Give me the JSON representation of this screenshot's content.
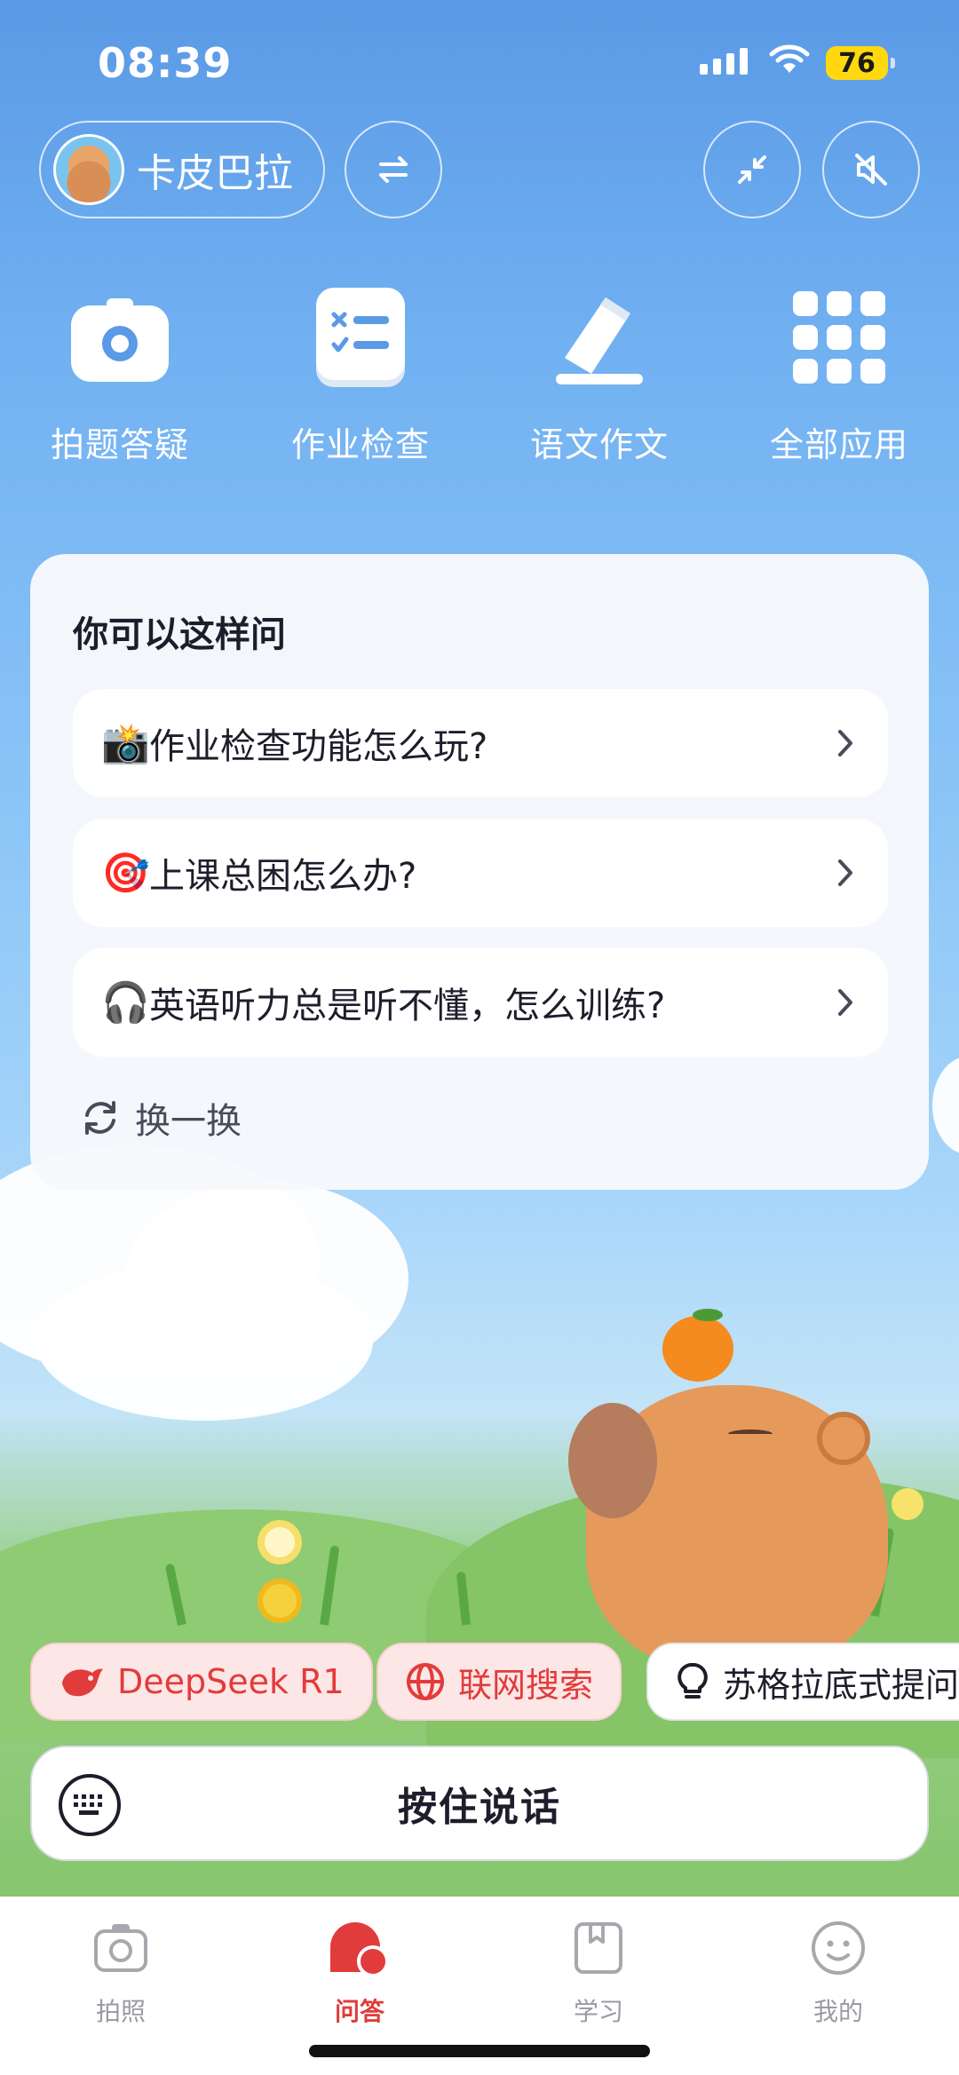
{
  "status_bar": {
    "time": "08:39",
    "battery": "76"
  },
  "header": {
    "profile_name": "卡皮巴拉",
    "icons": [
      "swap-icon",
      "collapse-icon",
      "mute-icon"
    ]
  },
  "quick_apps": [
    {
      "label": "拍题答疑",
      "icon": "camera-icon"
    },
    {
      "label": "作业检查",
      "icon": "homework-check-icon"
    },
    {
      "label": "语文作文",
      "icon": "pen-icon"
    },
    {
      "label": "全部应用",
      "icon": "grid-icon"
    }
  ],
  "suggestions": {
    "title": "你可以这样问",
    "items": [
      {
        "emoji": "📸",
        "text": "作业检查功能怎么玩?"
      },
      {
        "emoji": "🎯",
        "text": "上课总困怎么办?"
      },
      {
        "emoji": "🎧",
        "text": "英语听力总是听不懂，怎么训练?"
      }
    ],
    "refresh_label": "换一换"
  },
  "chips": [
    {
      "label": "DeepSeek R1",
      "style": "red",
      "icon": "deepseek-icon"
    },
    {
      "label": "联网搜索",
      "style": "red",
      "icon": "globe-icon"
    },
    {
      "label": "苏格拉底式提问",
      "style": "white",
      "icon": "lightbulb-icon"
    }
  ],
  "voice_input": {
    "label": "按住说话"
  },
  "tabs": [
    {
      "label": "拍照",
      "icon": "camera-tab-icon",
      "active": false
    },
    {
      "label": "问答",
      "icon": "chat-tab-icon",
      "active": true
    },
    {
      "label": "学习",
      "icon": "book-tab-icon",
      "active": false
    },
    {
      "label": "我的",
      "icon": "profile-tab-icon",
      "active": false
    }
  ],
  "colors": {
    "accent": "#e23b3b",
    "sky": "#73b2f2",
    "grass": "#7cbf5e"
  }
}
